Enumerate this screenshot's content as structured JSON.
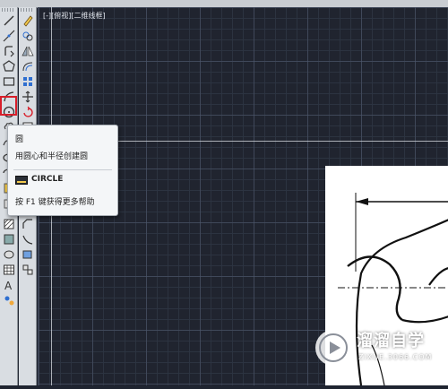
{
  "viewport": {
    "label": "[-][俯视][二维线框]"
  },
  "tooltip": {
    "title": "圆",
    "description": "用圆心和半径创建圆",
    "command": "CIRCLE",
    "help": "按 F1 键获得更多帮助"
  },
  "toolbar_left": {
    "tools": [
      "line-icon",
      "construction-line-icon",
      "polyline-icon",
      "polygon-icon",
      "rectangle-icon",
      "arc-icon",
      "circle-icon",
      "revision-cloud-icon",
      "spline-icon",
      "ellipse-icon",
      "ellipse-arc-icon",
      "insert-block-icon",
      "make-block-icon",
      "point-icon",
      "hatch-icon",
      "gradient-icon",
      "region-icon",
      "table-icon",
      "multiline-text-icon",
      "add-selected-icon"
    ]
  },
  "toolbar_right": {
    "tools": [
      "erase-icon",
      "copy-icon",
      "mirror-icon",
      "offset-icon",
      "array-icon",
      "move-icon",
      "rotate-icon",
      "scale-icon",
      "stretch-icon",
      "trim-icon",
      "extend-icon",
      "break-icon",
      "join-icon",
      "chamfer-icon",
      "fillet-icon",
      "blend-icon",
      "explode-icon"
    ]
  },
  "highlight_color": "#d81e2a",
  "watermark": {
    "title": "溜溜自学",
    "subtitle": "ZIXUE.3066.COM"
  }
}
